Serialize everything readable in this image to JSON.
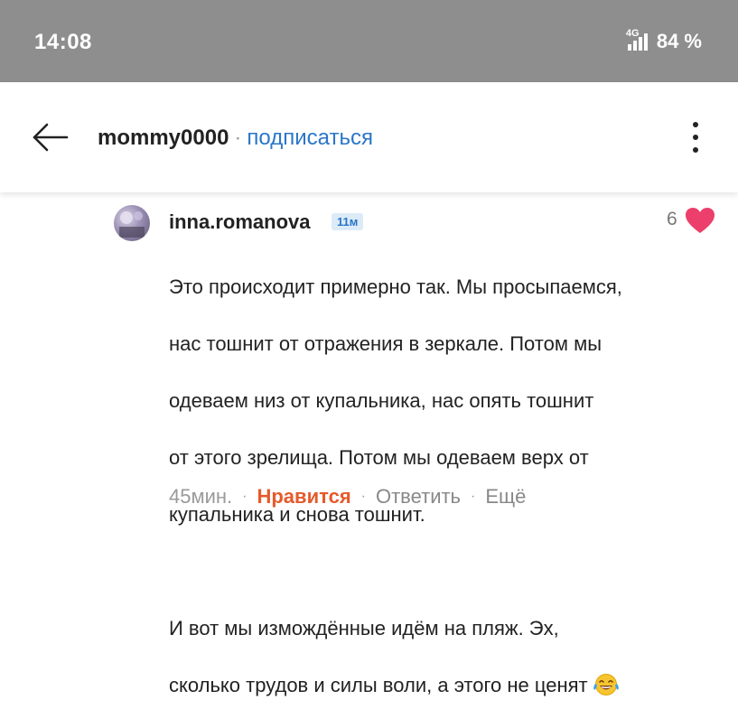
{
  "status_bar": {
    "time": "14:08",
    "network": "4G",
    "battery": "84 %"
  },
  "header": {
    "username": "mommy0000",
    "separator": "·",
    "follow_label": "подписаться"
  },
  "comment": {
    "author": "inna.romanova",
    "badge": "11м",
    "like_count": "6",
    "text_line_1": "Это происходит примерно так. Мы просыпаемся,",
    "text_line_2": "нас тошнит от отражения в зеркале. Потом мы",
    "text_line_3": "одеваем низ от купальника, нас опять тошнит",
    "text_line_4": "от этого зрелища. Потом мы одеваем верх от",
    "text_line_5": "купальника и снова тошнит.",
    "text_line_6": "И вот мы измождённые идём на пляж. Эх,",
    "text_line_7": "сколько трудов и силы воли, а этого не ценят",
    "emoji": "laughing-tears-emoji",
    "actions": {
      "time": "45мин.",
      "dot": "·",
      "like_label": "Нравится",
      "reply_label": "Ответить",
      "more_label": "Ещё"
    }
  },
  "colors": {
    "status_bar_bg": "#8e8e8e",
    "link_blue": "#2a76c8",
    "like_orange": "#e55a2b",
    "heart_pink": "#ec3f6b"
  }
}
